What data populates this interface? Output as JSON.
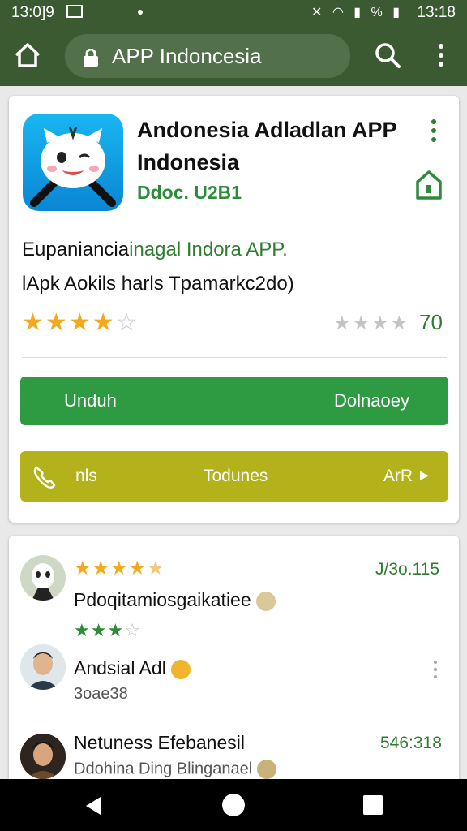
{
  "status_bar": {
    "time_left": "13:0]9",
    "time_right": "13:18",
    "battery": "%"
  },
  "browser": {
    "url_text": "APP Indoncesia"
  },
  "app": {
    "title": "Andonesia Adladlan APP Indonesia",
    "developer": "Ddoc. U2B1",
    "description_line1_prefix": "Eupaniancia",
    "description_line1_highlight": "inagal Indora APP.",
    "description_line2": "lApk Aokils harls Tpamarkc2do)",
    "rating_count": "70",
    "star_rating": 3.5
  },
  "buttons": {
    "download_left": "Unduh",
    "download_right": "Dolnaoey",
    "yellow_left": "nls",
    "yellow_center": "Todunes",
    "yellow_right": "ArR"
  },
  "reviews": [
    {
      "title": "Pdoqitamiosgaikatiee",
      "date": "J/3o.115",
      "rating": 4.5,
      "sub_rating": 3
    },
    {
      "name": "Andsial Adl",
      "sub": "3oae38"
    },
    {
      "name": "Netuness Efebanesil",
      "date": "546:318",
      "sub": "Ddohina Ding Blinganael"
    }
  ],
  "colors": {
    "appbar": "#3b5a32",
    "green_button": "#2e9b43",
    "yellow_button": "#b3b21a",
    "accent_green": "#2e7d32",
    "star": "#f4a91c"
  }
}
